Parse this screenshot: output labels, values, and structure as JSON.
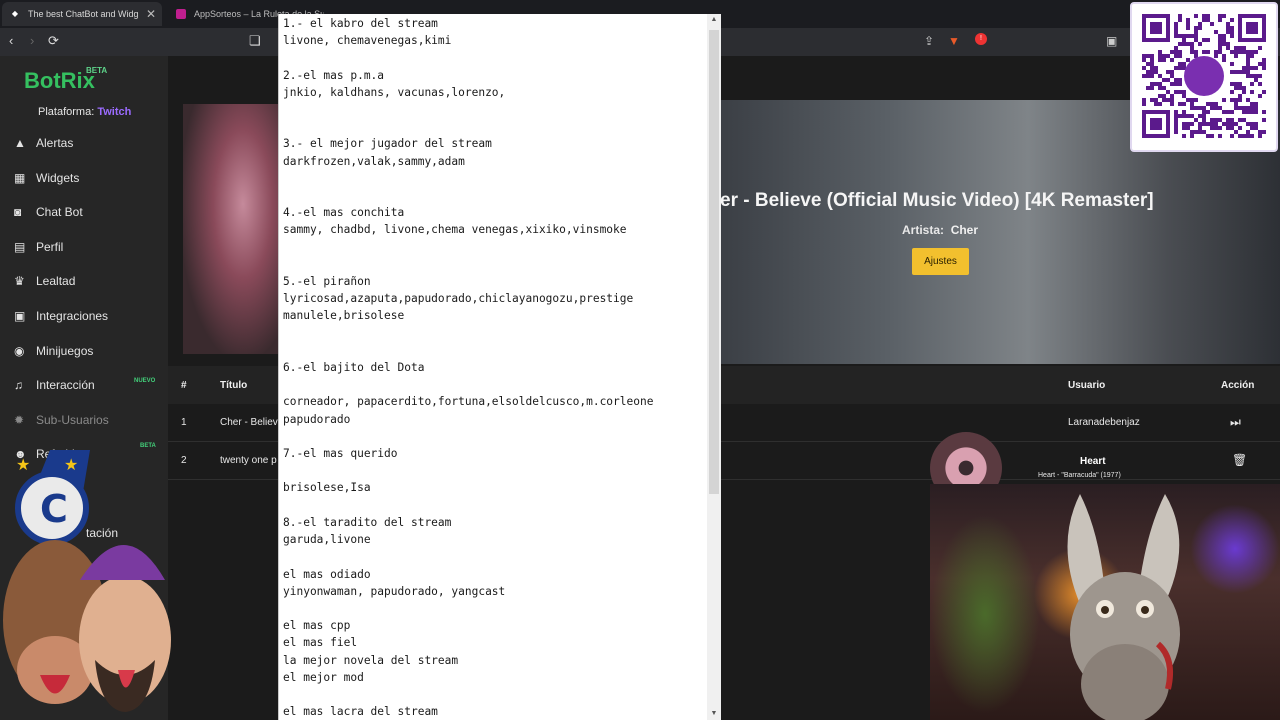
{
  "browser": {
    "tabs": [
      {
        "title": "The best ChatBot and Widget",
        "active": true
      },
      {
        "title": "AppSorteos – La Ruleta de la Suerte",
        "active": false
      }
    ]
  },
  "sidebar": {
    "logo": "BotRix",
    "logo_badge": "BETA",
    "platform_label": "Plataforma:",
    "platform_value": "Twitch",
    "items": [
      {
        "label": "Alertas",
        "icon": "warning-icon"
      },
      {
        "label": "Widgets",
        "icon": "grid-icon"
      },
      {
        "label": "Chat Bot",
        "icon": "robot-icon"
      },
      {
        "label": "Perfil",
        "icon": "id-card-icon"
      },
      {
        "label": "Lealtad",
        "icon": "trophy-icon"
      },
      {
        "label": "Integraciones",
        "icon": "plug-icon"
      },
      {
        "label": "Minijuegos",
        "icon": "gamepad-icon"
      },
      {
        "label": "Interacción",
        "icon": "music-icon",
        "tag": "NUEVO"
      },
      {
        "label": "Sub-Usuarios",
        "icon": "gear-icon"
      },
      {
        "label": "Referidos",
        "icon": "users-icon",
        "tag": "BETA"
      }
    ],
    "partial_item": "tación"
  },
  "player": {
    "title": "er - Believe (Official Music Video) [4K Remaster]",
    "artist_label": "Artista:",
    "artist": "Cher",
    "settings_button": "Ajustes"
  },
  "queue": {
    "headers": {
      "num": "#",
      "title": "Título",
      "user": "Usuario",
      "action": "Acción"
    },
    "rows": [
      {
        "num": "1",
        "title": "Cher - Believ",
        "user": "Laranadebenjaz",
        "action_icon": "skip-forward-icon"
      },
      {
        "num": "2",
        "title": "twenty one p",
        "user": "",
        "action_icon": "trash-icon"
      }
    ]
  },
  "notepad": {
    "lines": [
      "1.- el kabro del stream",
      "livone, chemavenegas,kimi",
      "",
      "2.-el mas p.m.a",
      "jnkio, kaldhans, vacunas,lorenzo,",
      "",
      "",
      "3.- el mejor jugador del stream",
      "darkfrozen,valak,sammy,adam",
      "",
      "",
      "4.-el mas conchita",
      "sammy, chadbd, livone,chema venegas,xixiko,vinsmoke",
      "",
      "",
      "5.-el pirañon",
      "lyricosad,azaputa,papudorado,chiclayanogozu,prestige",
      "manulele,brisolese",
      "",
      "",
      "6.-el bajito del Dota",
      "",
      "corneador, papacerdito,fortuna,elsoldelcusco,m.corleone",
      "papudorado",
      "",
      "7.-el mas querido",
      "",
      "brisolese,Isa",
      "",
      "8.-el taradito del stream",
      "garuda,livone",
      "",
      "el mas odiado",
      "yinyonwaman, papudorado, yangcast",
      "",
      "el mas cpp",
      "el mas fiel",
      "la mejor novela del stream",
      "el mejor mod",
      "",
      "el mas lacra del stream"
    ]
  },
  "now_playing": {
    "artist": "Heart",
    "song": "Heart - \"Barracuda\" (1977)"
  },
  "colors": {
    "brand_green": "#35c060",
    "twitch_purple": "#9b6bff",
    "settings_yellow": "#f2c02e"
  }
}
